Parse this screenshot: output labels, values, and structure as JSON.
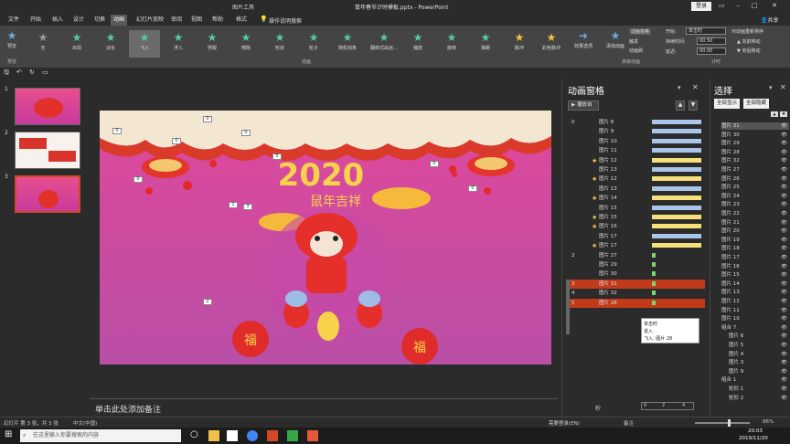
{
  "titlebar": {
    "context": "图片工具",
    "title": "鼠年春节计时模板.pptx  -  PowerPoint",
    "login": "登录",
    "share": "共享"
  },
  "tabs": [
    "文件",
    "开始",
    "插入",
    "设计",
    "切换",
    "动画",
    "幻灯片放映",
    "审阅",
    "视图",
    "帮助",
    "格式"
  ],
  "tell_me": "操作说明搜索",
  "ribbon": {
    "preview": "预览",
    "effects": [
      "无",
      "出现",
      "淡化",
      "飞入",
      "浮入",
      "劈裂",
      "擦除",
      "形状",
      "轮子",
      "随机线条",
      "翻转式由远...",
      "缩放",
      "旋转",
      "弹跳",
      "脉冲",
      "彩色脉冲"
    ],
    "effect_options": "效果选项",
    "add_animation": "添加动画",
    "anim_pane": "动画窗格",
    "trigger": "触发",
    "anim_painter": "动画刷",
    "start_label": "开始:",
    "start_value": "单击时",
    "duration_label": "持续时间:",
    "duration_value": "00.50",
    "delay_label": "延迟:",
    "delay_value": "00.00",
    "reorder": "对动画重新排序",
    "move_earlier": "向前移动",
    "move_later": "向后移动",
    "groups": {
      "preview": "预览",
      "animation": "动画",
      "advanced": "高级动画",
      "timing": "计时"
    }
  },
  "slides": [
    "1",
    "2",
    "3"
  ],
  "slide": {
    "year": "2020",
    "subtitle": "鼠年吉祥",
    "fu": "福"
  },
  "notes_placeholder": "单击此处添加备注",
  "anim_pane": {
    "title": "动画窗格",
    "play": "播放自",
    "rows": [
      {
        "num": "0",
        "name": "图片 8",
        "star": "",
        "color": "#a9c6e8"
      },
      {
        "num": "",
        "name": "图片 9",
        "star": "",
        "color": "#a9c6e8"
      },
      {
        "num": "",
        "name": "图片 10",
        "star": "",
        "color": "#a9c6e8"
      },
      {
        "num": "",
        "name": "图片 11",
        "star": "",
        "color": "#a9c6e8"
      },
      {
        "num": "",
        "name": "图片 12",
        "star": "★",
        "color": "#f5e07a"
      },
      {
        "num": "",
        "name": "图片 13",
        "star": "",
        "color": "#a9c6e8"
      },
      {
        "num": "",
        "name": "图片 12",
        "star": "★",
        "color": "#f5e07a"
      },
      {
        "num": "",
        "name": "图片 13",
        "star": "",
        "color": "#a9c6e8"
      },
      {
        "num": "",
        "name": "图片 14",
        "star": "★",
        "color": "#f5e07a"
      },
      {
        "num": "",
        "name": "图片 15",
        "star": "",
        "color": "#a9c6e8"
      },
      {
        "num": "",
        "name": "图片 15",
        "star": "★",
        "color": "#f5e07a"
      },
      {
        "num": "",
        "name": "图片 16",
        "star": "★",
        "color": "#f5e07a"
      },
      {
        "num": "",
        "name": "图片 17",
        "star": "",
        "color": "#a9c6e8"
      },
      {
        "num": "",
        "name": "图片 17",
        "star": "★",
        "color": "#f5e07a"
      },
      {
        "num": "2",
        "name": "图片 27",
        "star": "",
        "color": "#7fd46b"
      },
      {
        "num": "",
        "name": "图片 29",
        "star": "",
        "color": "#7fd46b"
      },
      {
        "num": "",
        "name": "图片 30",
        "star": "",
        "color": "#7fd46b"
      },
      {
        "num": "3",
        "name": "图片 31",
        "star": "",
        "color": "#7fd46b",
        "sel": true
      },
      {
        "num": "4",
        "name": "图片 32",
        "star": "",
        "color": "#7fd46b"
      },
      {
        "num": "5",
        "name": "图片 28",
        "star": "",
        "color": "#7fd46b",
        "sel": true
      }
    ],
    "tooltip": [
      "单击时",
      "进入",
      "飞入: 图片 28"
    ],
    "seconds": "秒",
    "ticks": [
      "0",
      "2",
      "4"
    ]
  },
  "selection_pane": {
    "title": "选择",
    "show_all": "全部显示",
    "hide_all": "全部隐藏",
    "items": [
      "图片 31",
      "图片 30",
      "图片 29",
      "图片 28",
      "图片 32",
      "图片 27",
      "图片 26",
      "图片 25",
      "图片 24",
      "图片 23",
      "图片 22",
      "图片 21",
      "图片 20",
      "图片 19",
      "图片 18",
      "图片 17",
      "图片 16",
      "图片 15",
      "图片 14",
      "图片 13",
      "图片 12",
      "图片 11",
      "图片 10",
      "组合 7",
      "图片 6",
      "图片 5",
      "图片 4",
      "图片 3",
      "图片 9",
      "组合 1",
      "矩形 1",
      "矩形 2"
    ]
  },
  "status": {
    "slide": "幻灯片 第 3 张，共 3 张",
    "lang": "中文(中国)",
    "notes": "备注",
    "repair": "需要登录(EN)",
    "zoom": "86%"
  },
  "taskbar": {
    "search": "在这里输入你要搜索的内容",
    "time": "20:03",
    "date": "2019/11/20"
  }
}
